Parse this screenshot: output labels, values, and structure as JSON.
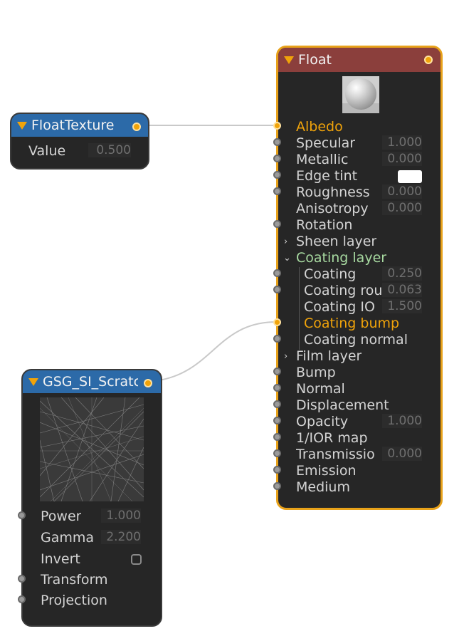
{
  "colors": {
    "accent": "#f0a30a",
    "float_header": "#8b3f3c",
    "node_header_blue": "#2c6aa8",
    "node_bg": "#262626"
  },
  "nodes": {
    "float_texture": {
      "title": "FloatTexture",
      "rows": [
        {
          "label": "Value",
          "value": "0.500"
        }
      ]
    },
    "float": {
      "title": "Float",
      "rows": [
        {
          "label": "Albedo",
          "value": ""
        },
        {
          "label": "Specular",
          "value": "1.000"
        },
        {
          "label": "Metallic",
          "value": "0.000"
        },
        {
          "label": "Edge tint",
          "value": ""
        },
        {
          "label": "Roughness",
          "value": "0.000"
        },
        {
          "label": "Anisotropy",
          "value": "0.000"
        },
        {
          "label": "Rotation",
          "value": ""
        },
        {
          "label": "Sheen layer",
          "value": ""
        },
        {
          "label": "Coating layer",
          "value": ""
        },
        {
          "label": "Coating",
          "value": "0.250"
        },
        {
          "label": "Coating rou",
          "value": "0.063"
        },
        {
          "label": "Coating IO",
          "value": "1.500"
        },
        {
          "label": "Coating bump",
          "value": ""
        },
        {
          "label": "Coating normal",
          "value": ""
        },
        {
          "label": "Film layer",
          "value": ""
        },
        {
          "label": "Bump",
          "value": ""
        },
        {
          "label": "Normal",
          "value": ""
        },
        {
          "label": "Displacement",
          "value": ""
        },
        {
          "label": "Opacity",
          "value": "1.000"
        },
        {
          "label": "1/IOR map",
          "value": ""
        },
        {
          "label": "Transmissio",
          "value": "0.000"
        },
        {
          "label": "Emission",
          "value": ""
        },
        {
          "label": "Medium",
          "value": ""
        }
      ]
    },
    "scratch": {
      "title": "GSG_SI_Scratc",
      "rows": [
        {
          "label": "Power",
          "value": "1.000"
        },
        {
          "label": "Gamma",
          "value": "2.200"
        },
        {
          "label": "Invert",
          "value": ""
        },
        {
          "label": "Transform",
          "value": ""
        },
        {
          "label": "Projection",
          "value": ""
        }
      ]
    }
  }
}
